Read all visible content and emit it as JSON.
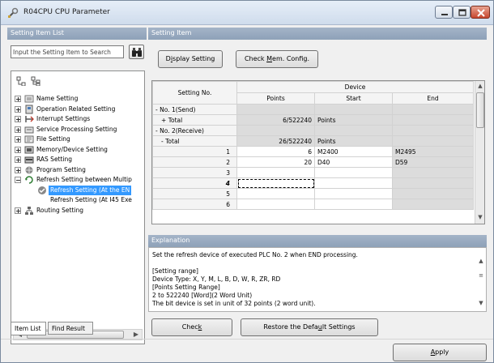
{
  "window": {
    "title": "R04CPU CPU Parameter",
    "icon": "parameter-wrench-icon"
  },
  "left": {
    "header": "Setting Item List",
    "search_placeholder": "Input the Setting Item to Search",
    "tree": [
      {
        "label": "Name Setting",
        "icon": "name-icon",
        "expander": "+",
        "indent": 0
      },
      {
        "label": "Operation Related Setting",
        "icon": "operation-icon",
        "expander": "+",
        "indent": 0
      },
      {
        "label": "Interrupt Settings",
        "icon": "interrupt-icon",
        "expander": "+",
        "indent": 0
      },
      {
        "label": "Service Processing Setting",
        "icon": "service-icon",
        "expander": "+",
        "indent": 0
      },
      {
        "label": "File Setting",
        "icon": "file-icon",
        "expander": "+",
        "indent": 0
      },
      {
        "label": "Memory/Device Setting",
        "icon": "memory-icon",
        "expander": "+",
        "indent": 0
      },
      {
        "label": "RAS Setting",
        "icon": "ras-icon",
        "expander": "+",
        "indent": 0
      },
      {
        "label": "Program Setting",
        "icon": "program-icon",
        "expander": "+",
        "indent": 0
      },
      {
        "label": "Refresh Setting between Multip",
        "icon": "refresh-icon",
        "expander": "-",
        "indent": 0
      },
      {
        "label": "Refresh Setting (At the EN",
        "icon": "check-circle-icon",
        "expander": "",
        "indent": 1,
        "selected": true
      },
      {
        "label": "Refresh Setting (At I45 Exe",
        "icon": "",
        "expander": "",
        "indent": 1
      },
      {
        "label": "Routing Setting",
        "icon": "routing-icon",
        "expander": "+",
        "indent": 0
      }
    ],
    "scroll_thumb_text": "III",
    "tabs": [
      "Item List",
      "Find Result"
    ]
  },
  "right": {
    "header": "Setting Item",
    "display_setting": {
      "pre": "D",
      "ul": "i",
      "post": "splay Setting"
    },
    "check_mem": {
      "pre": "Check ",
      "ul": "M",
      "post": "em. Config."
    },
    "grid": {
      "col_setting_no": "Setting No.",
      "col_device": "Device",
      "col_points": "Points",
      "col_start": "Start",
      "col_end": "End",
      "rows": [
        {
          "label": "No. 1(Send)",
          "expander": "-",
          "points": "",
          "start": "",
          "end": "",
          "type": "group"
        },
        {
          "label": "Total",
          "expander": "+",
          "points": "6/522240",
          "start": "Points",
          "end": "",
          "type": "total"
        },
        {
          "label": "No. 2(Receive)",
          "expander": "-",
          "points": "",
          "start": "",
          "end": "",
          "type": "group"
        },
        {
          "label": "Total",
          "expander": "-",
          "points": "26/522240",
          "start": "Points",
          "end": "",
          "type": "total"
        },
        {
          "label": "1",
          "points": "6",
          "start": "M2400",
          "end": "M2495",
          "type": "row"
        },
        {
          "label": "2",
          "points": "20",
          "start": "D40",
          "end": "D59",
          "type": "row"
        },
        {
          "label": "3",
          "points": "",
          "start": "",
          "end": "",
          "type": "row"
        },
        {
          "label": "4",
          "points": "",
          "start": "",
          "end": "",
          "type": "row-active"
        },
        {
          "label": "5",
          "points": "",
          "start": "",
          "end": "",
          "type": "row"
        },
        {
          "label": "6",
          "points": "",
          "start": "",
          "end": "",
          "type": "row"
        }
      ]
    },
    "explanation_header": "Explanation",
    "explanation_lines": [
      "Set the refresh device of executed PLC No. 2 when END processing.",
      "",
      "[Setting range]",
      "Device Type: X, Y, M, L, B, D, W, R, ZR, RD",
      "[Points Setting Range]",
      "2 to 522240 [Word](2 Word Unit)",
      "The bit device is set in unit of 32 points (2 word unit)."
    ],
    "check_btn": {
      "pre": "Chec",
      "ul": "k",
      "post": ""
    },
    "restore_btn": {
      "pre": "Restore the Defa",
      "ul": "u",
      "post": "lt Settings"
    },
    "apply_btn": {
      "pre": "",
      "ul": "A",
      "post": "pply"
    }
  }
}
